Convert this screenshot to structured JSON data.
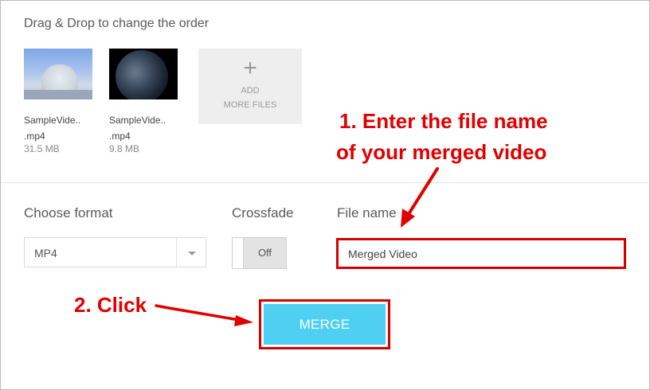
{
  "drag_title": "Drag & Drop to change the order",
  "files": [
    {
      "name_line1": "SampleVide..",
      "name_line2": ".mp4",
      "size": "31.5 MB"
    },
    {
      "name_line1": "SampleVide..",
      "name_line2": ".mp4",
      "size": "9.8 MB"
    }
  ],
  "add_files": {
    "icon": "plus-icon",
    "symbol": "+",
    "line1": "ADD",
    "line2": "MORE FILES"
  },
  "format": {
    "label": "Choose format",
    "selected": "MP4"
  },
  "crossfade": {
    "label": "Crossfade",
    "state": "Off"
  },
  "file_name": {
    "label": "File name",
    "value": "Merged Video"
  },
  "merge_label": "MERGE",
  "annotations": {
    "step1_line1": "1. Enter the file name",
    "step1_line2": "of your merged video",
    "step2": "2. Click"
  },
  "colors": {
    "annotation_red": "#e00000",
    "merge_button": "#4fd0f2"
  }
}
